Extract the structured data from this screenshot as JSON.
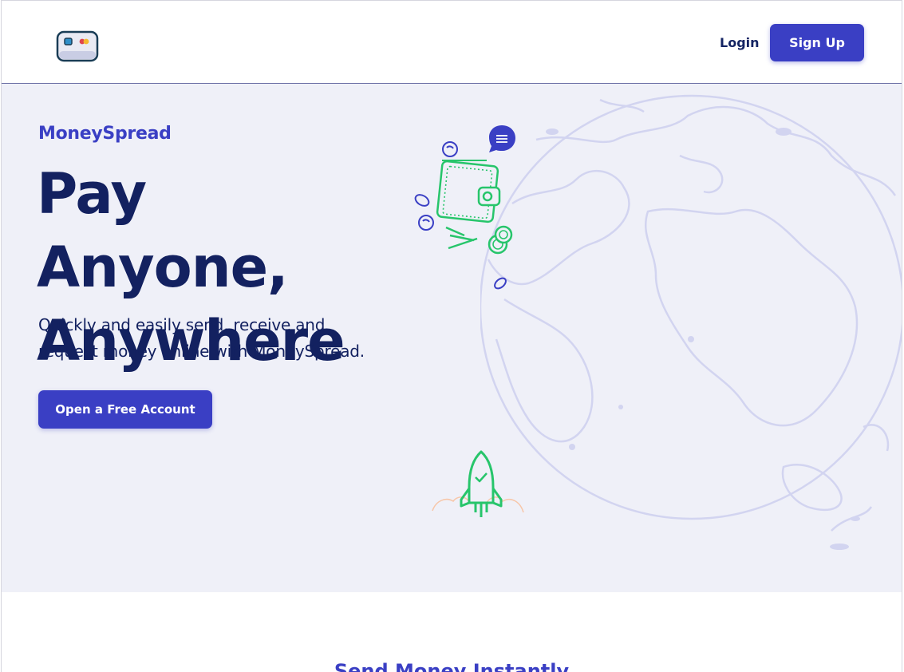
{
  "nav": {
    "logo_icon": "card-logo-icon",
    "login_label": "Login",
    "signup_label": "Sign Up"
  },
  "hero": {
    "brand": "MoneySpread",
    "headline_line1": "Pay Anyone,",
    "headline_line2": "Anywhere",
    "subtitle_line1": "Quickly and easily send, receive and",
    "subtitle_line2": "request money online with MoneySpread.",
    "cta_label": "Open a Free Account",
    "illustrations": [
      "world-globe",
      "wallet-icon",
      "coin-icon",
      "chat-bubble-icon",
      "rocket-icon"
    ]
  },
  "next_section": {
    "title": "Send Money Instantly"
  },
  "colors": {
    "primary": "#3a3fc4",
    "heading": "#132160",
    "hero_bg": "#eff0f8",
    "illustration_green": "#2ecc71"
  }
}
